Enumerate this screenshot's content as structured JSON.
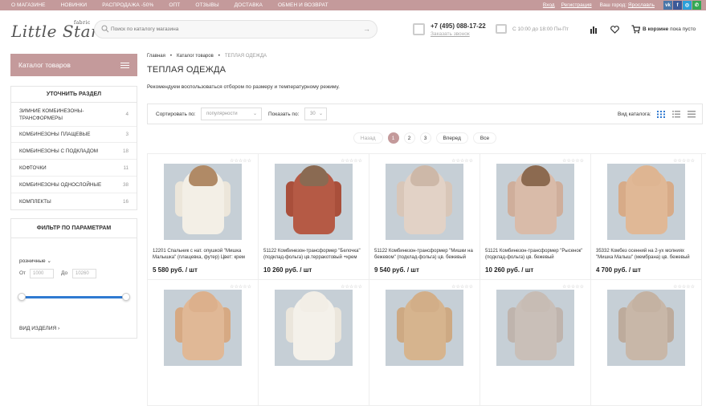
{
  "topnav": [
    "О МАГАЗИНЕ",
    "НОВИНКИ",
    "РАСПРОДАЖА -50%",
    "ОПТ",
    "ОТЗЫВЫ",
    "ДОСТАВКА",
    "ОБМЕН И ВОЗВРАТ"
  ],
  "auth": {
    "login": "Вход",
    "register": "Регистрация"
  },
  "city": {
    "label": "Ваш город:",
    "value": "Ярославль"
  },
  "social": [
    {
      "name": "vk-icon",
      "glyph": "vk",
      "color": "#4a76a8"
    },
    {
      "name": "facebook-icon",
      "glyph": "f",
      "color": "#3b5998"
    },
    {
      "name": "instagram-icon",
      "glyph": "◎",
      "color": "#2b9fd9"
    },
    {
      "name": "whatsapp-icon",
      "glyph": "✆",
      "color": "#34a853"
    }
  ],
  "logo": {
    "main": "Little Star",
    "sup": "fabric"
  },
  "search": {
    "placeholder": "Поиск по каталогу магазина"
  },
  "contact": {
    "phone": "+7 (495) 088-17-22",
    "callback": "Заказать звонок",
    "hours": "С 10:00 до 18:00 Пн-Пт"
  },
  "cart": {
    "label": "В корзине",
    "value": "пока пусто"
  },
  "sidebar": {
    "catalog_button": "Каталог товаров",
    "refine_title": "УТОЧНИТЬ РАЗДЕЛ",
    "categories": [
      {
        "label": "ЗИМНИЕ КОМБИНЕЗОНЫ-ТРАНСФОРМЕРЫ",
        "count": "4"
      },
      {
        "label": "КОМБИНЕЗОНЫ ПЛАЩЕВЫЕ",
        "count": "3"
      },
      {
        "label": "КОМБИНЕЗОНЫ С ПОДКЛАДОМ",
        "count": "18"
      },
      {
        "label": "КОФТОЧКИ",
        "count": "11"
      },
      {
        "label": "КОМБИНЕЗОНЫ ОДНОСЛОЙНЫЕ",
        "count": "38"
      },
      {
        "label": "КОМПЛЕКТЫ",
        "count": "16"
      }
    ],
    "filter_title": "ФИЛЬТР ПО ПАРАМЕТРАМ",
    "price_type": "розничные",
    "from_label": "От",
    "from_value": "1000",
    "to_label": "До",
    "to_value": "10260",
    "kind_label": "ВИД ИЗДЕЛИЯ"
  },
  "breadcrumb": {
    "home": "Главная",
    "catalog": "Каталог товаров",
    "current": "ТЕПЛАЯ ОДЕЖДА"
  },
  "page_title": "ТЕПЛАЯ ОДЕЖДА",
  "description": "Рекомендуем воспользоваться отбором по размеру и температурному режиму.",
  "sort": {
    "label": "Сортировать по:",
    "value": "популярности",
    "show_label": "Показать по:",
    "show_value": "30",
    "view_label": "Вид каталога:"
  },
  "pager": {
    "prev": "Назад",
    "pages": [
      "1",
      "2",
      "3"
    ],
    "next": "Вперед",
    "all": "Все"
  },
  "products": [
    {
      "name": "12201 Спальник с нат. опушкой \"Мишка Малышка\" (плащевка, футер) Цвет: крем",
      "price": "5 580 руб. / шт",
      "color": "#f3efe6",
      "arm": "#ece6da",
      "hood": "#b08a66"
    },
    {
      "name": "51122 Комбинезон-трансформер \"Белочка\" (подклад-фольга) цв.терракотовый +крем",
      "price": "10 260 руб. / шт",
      "color": "#b55a45",
      "arm": "#a94f3b",
      "hood": "#8a6a52"
    },
    {
      "name": "51122 Комбинезон-трансформер \"Мишки на бежевом\" (подклад-фольга) цв. бежевый",
      "price": "9 540 руб. / шт",
      "color": "#e2d2c6",
      "arm": "#d8c6b8",
      "hood": "#cdb8a8"
    },
    {
      "name": "51121 Комбинезон-трансформер \"Рысенок\" (подклад-фольга) цв. бежевый",
      "price": "10 260 руб. / шт",
      "color": "#d9bba9",
      "arm": "#cfae9b",
      "hood": "#8c6a50"
    },
    {
      "name": "35332 Комбез осенний на 2-ух молниях \"Мишка Малыш\" (мембрана) цв. бежевый",
      "price": "4 700 руб. / шт",
      "color": "#e0b896",
      "arm": "#d7ab88",
      "hood": "#deb592"
    },
    {
      "name": "",
      "price": "",
      "color": "#e0b896",
      "arm": "#d6a983",
      "hood": "#dcb08c"
    },
    {
      "name": "",
      "price": "",
      "color": "#f4f1ea",
      "arm": "#ebe6dc",
      "hood": "#f2eee6"
    },
    {
      "name": "",
      "price": "",
      "color": "#d6b48e",
      "arm": "#cda983",
      "hood": "#d2ae88"
    },
    {
      "name": "",
      "price": "",
      "color": "#c9bfb8",
      "arm": "#bfb4ad",
      "hood": "#c7bcb4"
    },
    {
      "name": "",
      "price": "",
      "color": "#c8b7a8",
      "arm": "#bdab9c",
      "hood": "#c4b2a2"
    }
  ]
}
